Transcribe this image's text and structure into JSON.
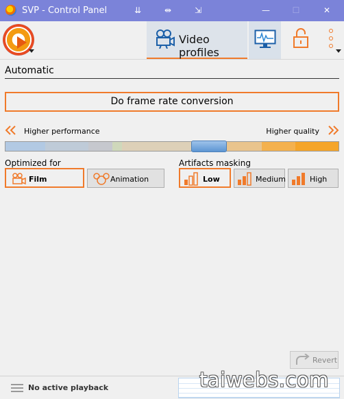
{
  "window": {
    "title": "SVP - Control Panel",
    "title_buttons": [
      "pin-down",
      "pin-side",
      "snap",
      "minimize",
      "maximize",
      "close"
    ],
    "title_glyphs": [
      "⇊",
      "⇹",
      "⇲",
      "—",
      "☐",
      "✕"
    ]
  },
  "toolbar": {
    "tabs": [
      {
        "label": "Video profiles",
        "icon": "camera-icon",
        "active": true
      },
      {
        "label": "",
        "icon": "monitor-icon",
        "active": false
      },
      {
        "label": "",
        "icon": "lock-icon",
        "active": false
      },
      {
        "label": "",
        "icon": "more-icon",
        "active": false
      }
    ]
  },
  "profile": {
    "name": "Automatic",
    "frame_rate_button": "Do frame rate conversion",
    "slider": {
      "left_label": "Higher performance",
      "right_label": "Higher quality",
      "position": 0.62
    },
    "optimized_for": {
      "label": "Optimized for",
      "options": [
        {
          "label": "Film",
          "selected": true
        },
        {
          "label": "Animation",
          "selected": false
        }
      ]
    },
    "artifacts": {
      "label": "Artifacts masking",
      "options": [
        {
          "label": "Low",
          "selected": true
        },
        {
          "label": "Medium",
          "selected": false
        },
        {
          "label": "High",
          "selected": false
        }
      ]
    }
  },
  "revert_label": "Revert",
  "status": {
    "text": "No active playback",
    "watermark": "taiwebs.com"
  },
  "colors": {
    "accent": "#f07a2a",
    "titlebar": "#7b83d9",
    "thumb": "#6fa2da"
  }
}
